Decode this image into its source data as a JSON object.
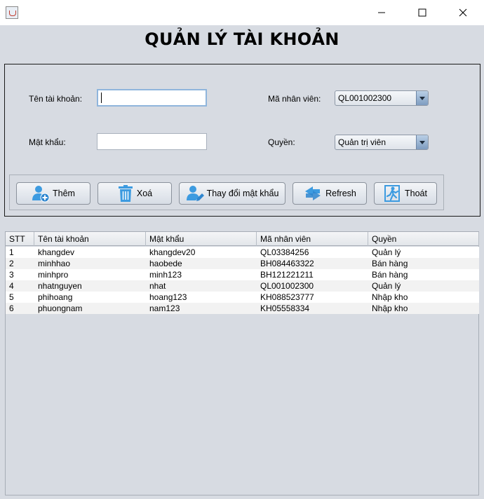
{
  "window": {
    "icon": "java-cup-icon"
  },
  "heading": "QUẢN LÝ TÀI KHOẢN",
  "form": {
    "username_label": "Tên tài khoản:",
    "username_value": "",
    "password_label": "Mật khẩu:",
    "password_value": "",
    "employee_label": "Mã nhân viên:",
    "employee_selected": "QL001002300",
    "role_label": "Quyền:",
    "role_selected": "Quản trị viên"
  },
  "buttons": {
    "add": "Thêm",
    "delete": "Xoá",
    "change_password": "Thay đổi mật khẩu",
    "refresh": "Refresh",
    "exit": "Thoát"
  },
  "table": {
    "columns": [
      "STT",
      "Tên tài khoản",
      "Mật khẩu",
      "Mã nhân viên",
      "Quyền"
    ],
    "rows": [
      [
        "1",
        "khangdev",
        "khangdev20",
        "QL03384256",
        "Quản lý"
      ],
      [
        "2",
        "minhhao",
        "haobede",
        "BH084463322",
        "Bán hàng"
      ],
      [
        "3",
        "minhpro",
        "minh123",
        "BH121221211",
        "Bán hàng"
      ],
      [
        "4",
        "nhatnguyen",
        "nhat",
        "QL001002300",
        "Quản lý"
      ],
      [
        "5",
        "phihoang",
        "hoang123",
        "KH088523777",
        "Nhập kho"
      ],
      [
        "6",
        "phuongnam",
        "nam123",
        "KH05558334",
        "Nhập kho"
      ]
    ]
  }
}
